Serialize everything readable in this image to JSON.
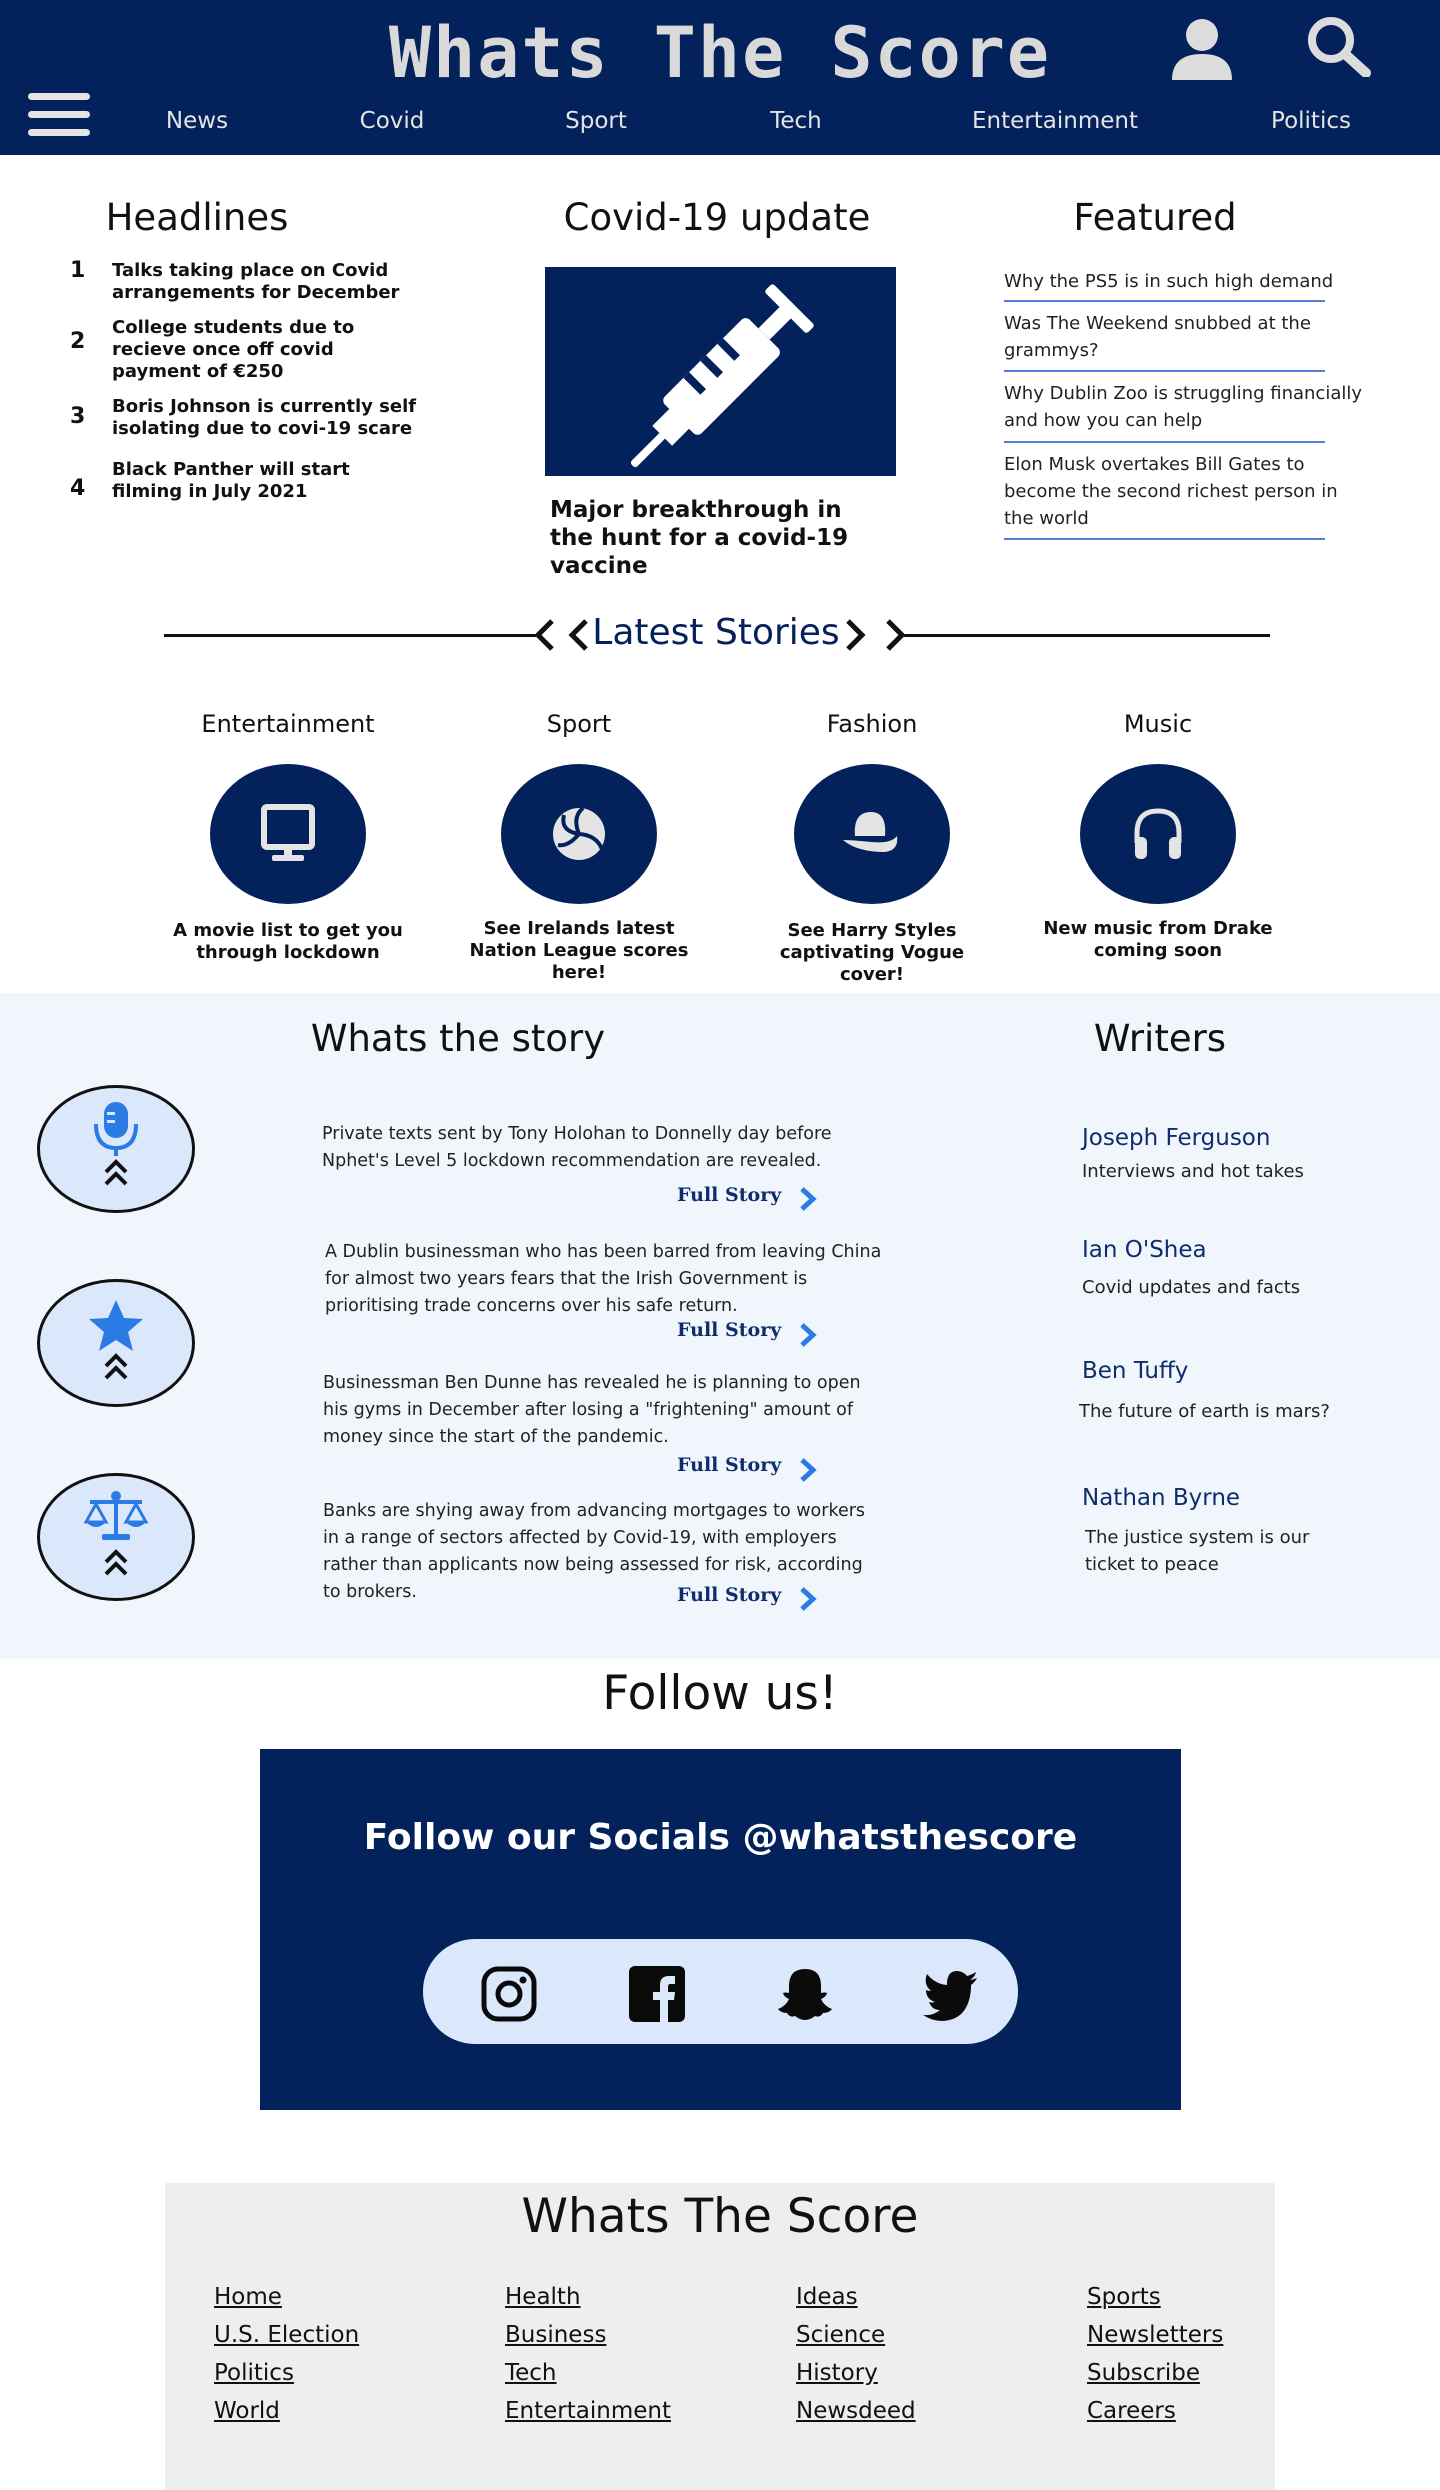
{
  "header": {
    "title": "Whats The Score",
    "nav": [
      "News",
      "Covid",
      "Sport",
      "Tech",
      "Entertainment",
      "Politics"
    ]
  },
  "headlines": {
    "title": "Headlines",
    "items": [
      {
        "num": "1",
        "text": "Talks taking place on Covid arrangements for December"
      },
      {
        "num": "2",
        "text": "College students due to recieve once off covid payment of €250"
      },
      {
        "num": "3",
        "text": "Boris Johnson is currently self isolating due to covi-19 scare"
      },
      {
        "num": "4",
        "text": "Black Panther will start filming in July 2021"
      }
    ]
  },
  "covid": {
    "title": "Covid-19 update",
    "caption": "Major breakthrough in the hunt for a covid-19 vaccine",
    "icon": "syringe-icon"
  },
  "featured": {
    "title": "Featured",
    "items": [
      "Why the PS5 is in such high demand",
      "Was The Weekend snubbed at the grammys?",
      "Why Dublin Zoo is struggling financially and how you can help",
      "Elon Musk overtakes Bill Gates to become the second richest person in the world"
    ]
  },
  "latest": {
    "title": "Latest Stories",
    "categories": [
      {
        "title": "Entertainment",
        "caption": "A movie list to get you through lockdown",
        "icon": "monitor-icon"
      },
      {
        "title": "Sport",
        "caption": "See Irelands latest Nation League scores here!",
        "icon": "volleyball-icon"
      },
      {
        "title": "Fashion",
        "caption": "See Harry Styles captivating Vogue cover!",
        "icon": "hat-icon"
      },
      {
        "title": "Music",
        "caption": "New music from Drake coming soon",
        "icon": "headphones-icon"
      }
    ]
  },
  "story": {
    "title": "Whats the story",
    "full_story_label": "Full Story",
    "items": [
      "Private texts sent by Tony Holohan to Donnelly day before Nphet's Level 5 lockdown recommendation are revealed.",
      "A Dublin businessman who has been barred from leaving China for almost two years fears that the Irish Government is prioritising trade concerns over his safe return.",
      "Businessman Ben Dunne has revealed he is planning to open his gyms in December after losing a \"frightening\" amount of money since the start of the pandemic.",
      "Banks are shying away from advancing mortgages to workers in a range of sectors affected by Covid-19, with employers rather than applicants now being assessed for risk, according to brokers."
    ],
    "badges": [
      "microphone-icon",
      "star-icon",
      "scales-icon"
    ]
  },
  "writers": {
    "title": "Writers",
    "items": [
      {
        "name": "Joseph Ferguson",
        "desc": "Interviews and hot takes"
      },
      {
        "name": "Ian O'Shea",
        "desc": "Covid updates and facts"
      },
      {
        "name": "Ben Tuffy",
        "desc": "The future of earth is mars?"
      },
      {
        "name": "Nathan Byrne",
        "desc": "The justice system is our ticket to peace"
      }
    ]
  },
  "follow": {
    "title": "Follow us!",
    "text": "Follow our Socials @whatsthescore",
    "socials": [
      "instagram-icon",
      "facebook-icon",
      "snapchat-icon",
      "twitter-icon"
    ]
  },
  "footer": {
    "title": "Whats The Score",
    "columns": [
      [
        "Home",
        "U.S. Election",
        "Politics",
        "World"
      ],
      [
        "Health",
        "Business",
        "Tech",
        "Entertainment"
      ],
      [
        "Ideas",
        "Science",
        "History",
        "Newsdeed"
      ],
      [
        "Sports",
        "Newsletters",
        "Subscribe",
        "Careers"
      ]
    ]
  },
  "colors": {
    "navy": "#03215a",
    "light_blue": "#dbe8fb",
    "accent_blue": "#2b7be4",
    "section_bg": "#f1f6fd"
  }
}
